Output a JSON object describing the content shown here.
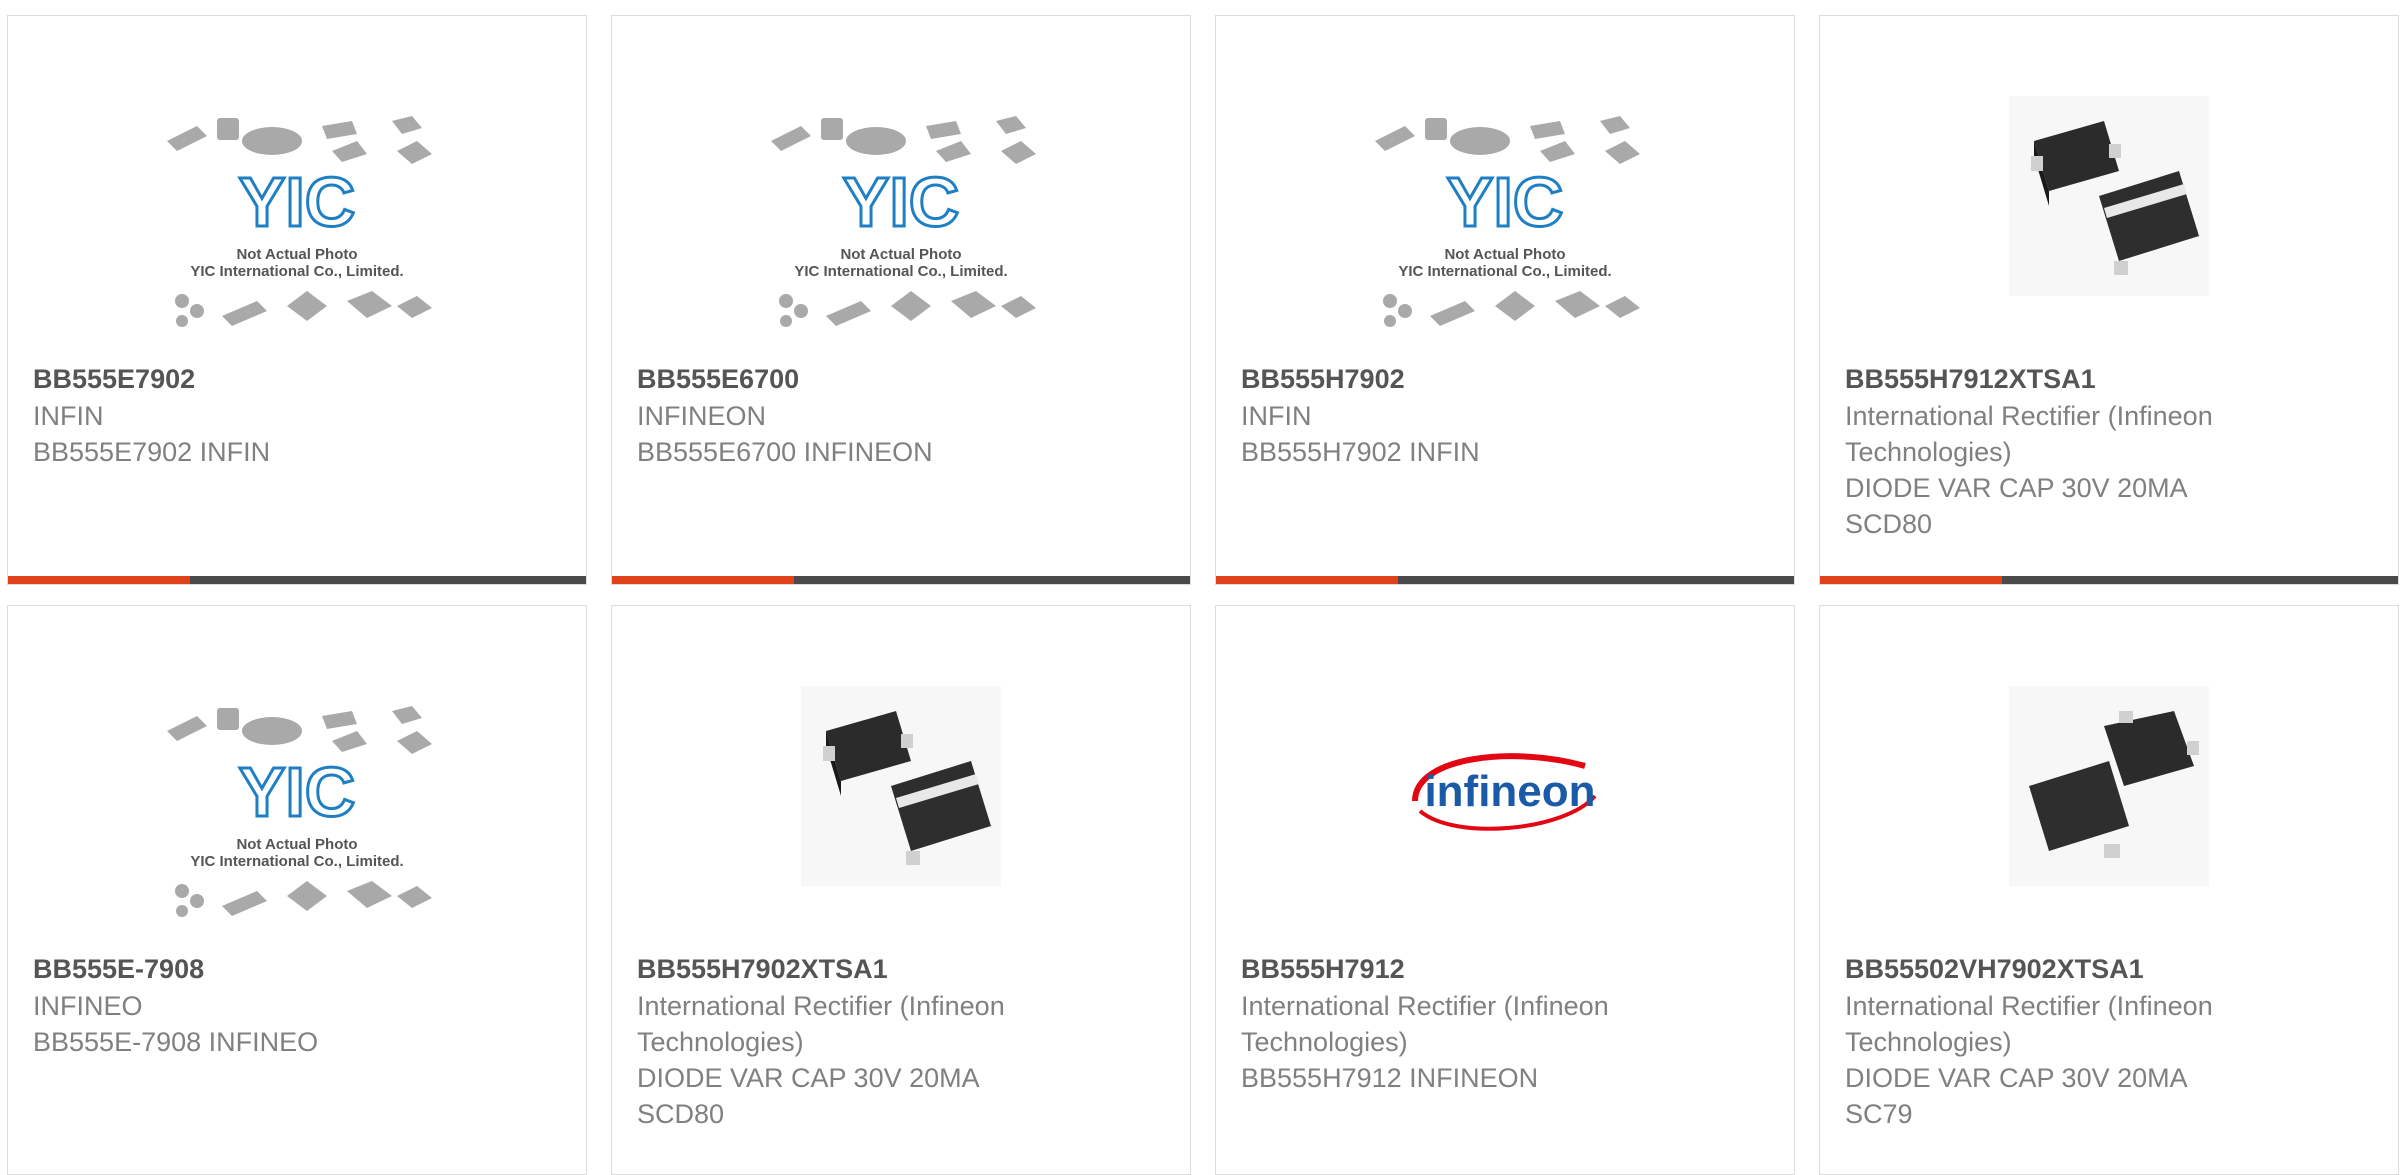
{
  "products": [
    {
      "part": "BB555E7902",
      "lines": [
        "INFIN",
        "BB555E7902 INFIN"
      ],
      "image": "yic-placeholder"
    },
    {
      "part": "BB555E6700",
      "lines": [
        "INFINEON",
        "BB555E6700 INFINEON"
      ],
      "image": "yic-placeholder"
    },
    {
      "part": "BB555H7902",
      "lines": [
        "INFIN",
        "BB555H7902 INFIN"
      ],
      "image": "yic-placeholder"
    },
    {
      "part": "BB555H7912XTSA1",
      "lines": [
        "International Rectifier (Infineon",
        "Technologies)",
        "DIODE VAR CAP 30V 20MA",
        "SCD80"
      ],
      "image": "diode-pair"
    },
    {
      "part": "BB555E-7908",
      "lines": [
        "INFINEO",
        "BB555E-7908 INFINEO"
      ],
      "image": "yic-placeholder"
    },
    {
      "part": "BB555H7902XTSA1",
      "lines": [
        "International Rectifier (Infineon",
        "Technologies)",
        "DIODE VAR CAP 30V 20MA",
        "SCD80"
      ],
      "image": "diode-pair"
    },
    {
      "part": "BB555H7912",
      "lines": [
        "International Rectifier (Infineon",
        "Technologies)",
        "BB555H7912 INFINEON"
      ],
      "image": "infineon-logo"
    },
    {
      "part": "BB55502VH7902XTSA1",
      "lines": [
        "International Rectifier (Infineon",
        "Technologies)",
        "DIODE VAR CAP 30V 20MA",
        "SC79"
      ],
      "image": "diode-pair-alt"
    }
  ],
  "placeholder": {
    "logo_text": "YIC",
    "caption_1": "Not Actual Photo",
    "caption_2": "YIC International Co., Limited."
  },
  "logo_text": "infineon",
  "colors": {
    "accent": "#e0411b",
    "bar": "#4a4a4a",
    "yic_blue": "#1e7fc4",
    "infineon_blue": "#1a5aa6",
    "infineon_red": "#e30613"
  }
}
